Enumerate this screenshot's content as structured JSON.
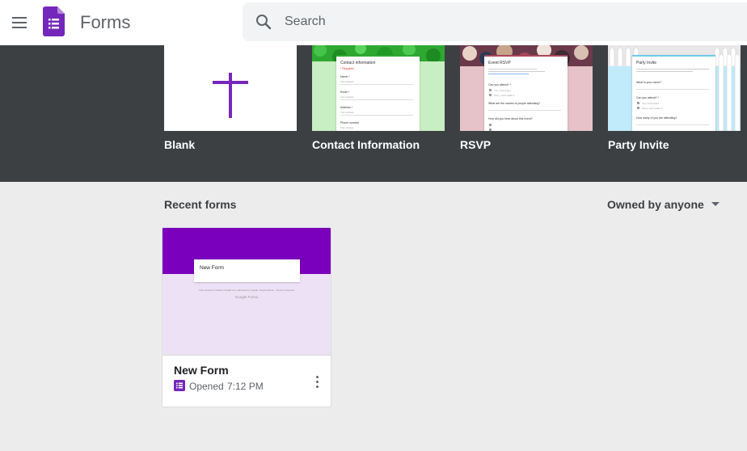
{
  "header": {
    "app_name": "Forms",
    "search_placeholder": "Search"
  },
  "templates": [
    {
      "label": "Blank"
    },
    {
      "label": "Contact Information",
      "preview": {
        "title": "Contact information",
        "required": "* Required",
        "fields": [
          "Name *",
          "Email *",
          "Address *",
          "Phone number"
        ],
        "answer_hint": "Your answer"
      }
    },
    {
      "label": "RSVP",
      "preview": {
        "title": "Event RSVP",
        "questions": [
          "Can you attend? *",
          "What are the names of people attending?",
          "How did you hear about this event?"
        ],
        "options": [
          "Yes, I'll be there",
          "Sorry, can't make it"
        ]
      }
    },
    {
      "label": "Party Invite",
      "preview": {
        "title": "Party Invite",
        "questions": [
          "What is your name?",
          "Can you attend? *",
          "How many of you are attending?"
        ],
        "options": [
          "Yes, I'll be there",
          "Sorry, can't make it"
        ]
      }
    }
  ],
  "recent": {
    "title": "Recent forms",
    "owner_filter": "Owned by anyone"
  },
  "documents": [
    {
      "title": "New Form",
      "preview_title": "New Form",
      "preview_footer": "This content is neither created nor endorsed by Google. Report Abuse · Terms of Service",
      "preview_brand": "Google Forms",
      "opened_label": "Opened",
      "opened_time": "7:12 PM"
    }
  ],
  "colors": {
    "accent": "#7627bb",
    "header_band": "#7b00bd",
    "gallery_bg": "#3c4043",
    "page_bg": "#ececec",
    "contact_theme": "#c8eec3",
    "rsvp_theme": "#e6c3c8",
    "party_theme": "#c1eafb"
  },
  "icons": {
    "menu": "hamburger-menu-icon",
    "logo": "forms-logo-icon",
    "search": "search-icon",
    "filter": "caret-down-icon",
    "doc_type": "forms-doc-icon",
    "more": "more-vert-icon"
  }
}
